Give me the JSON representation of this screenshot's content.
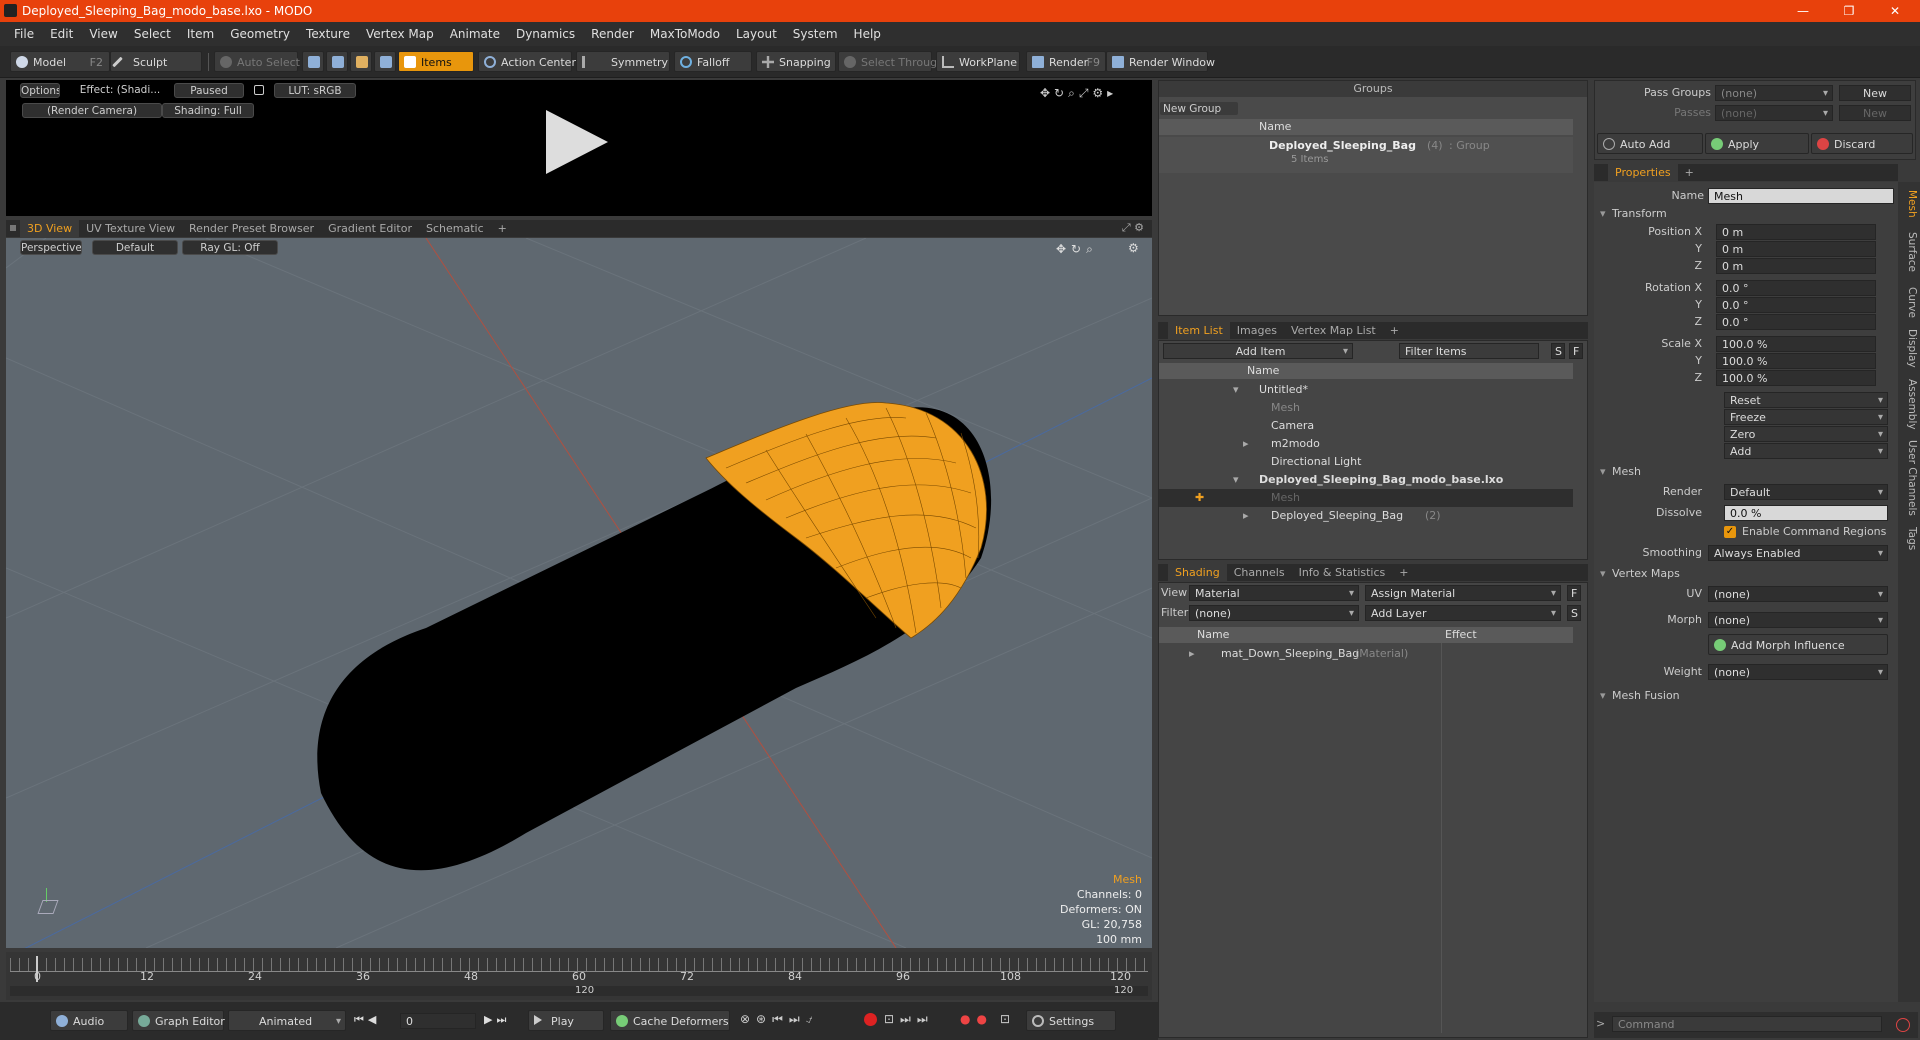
{
  "window": {
    "title": "Deployed_Sleeping_Bag_modo_base.lxo - MODO"
  },
  "menu": [
    "File",
    "Edit",
    "View",
    "Select",
    "Item",
    "Geometry",
    "Texture",
    "Vertex Map",
    "Animate",
    "Dynamics",
    "Render",
    "MaxToModo",
    "Layout",
    "System",
    "Help"
  ],
  "toolbar": {
    "model": "Model",
    "model_key": "F2",
    "sculpt": "Sculpt",
    "auto_select": "Auto Select",
    "items": "Items",
    "action_center": "Action Center",
    "symmetry": "Symmetry",
    "falloff": "Falloff",
    "snapping": "Snapping",
    "select_through": "Select Through",
    "workplane": "WorkPlane",
    "render": "Render",
    "render_key": "F9",
    "render_window": "Render Window"
  },
  "preview": {
    "options": "Options",
    "effect": "Effect: (Shadi...",
    "paused": "Paused",
    "lut": "LUT: sRGB",
    "camera": "(Render Camera)",
    "shading": "Shading: Full"
  },
  "view_tabs": [
    "3D View",
    "UV Texture View",
    "Render Preset Browser",
    "Gradient Editor",
    "Schematic",
    "+"
  ],
  "viewport": {
    "perspective": "Perspective",
    "default": "Default",
    "raygl": "Ray GL: Off",
    "info": {
      "mesh": "Mesh",
      "channels": "Channels: 0",
      "deformers": "Deformers: ON",
      "gl": "GL: 20,758",
      "unit": "100 mm"
    }
  },
  "timeline": {
    "ticks": [
      "0",
      "12",
      "24",
      "36",
      "48",
      "60",
      "72",
      "84",
      "96",
      "108",
      "120"
    ],
    "sub_mid": "120",
    "sub_end": "120"
  },
  "bottombar": {
    "audio": "Audio",
    "graph_editor": "Graph Editor",
    "animated": "Animated",
    "frame": "0",
    "play": "Play",
    "cache": "Cache Deformers",
    "settings": "Settings"
  },
  "groups": {
    "title": "Groups",
    "new_group": "New Group",
    "col_name": "Name",
    "item_name": "Deployed_Sleeping_Bag",
    "item_count": "(4)",
    "item_type": ": Group",
    "item_sub": "5 Items"
  },
  "itemlist": {
    "tabs": [
      "Item List",
      "Images",
      "Vertex Map List",
      "+"
    ],
    "add_item": "Add Item",
    "filter": "Filter Items",
    "s": "S",
    "f": "F",
    "col_name": "Name",
    "rows": [
      {
        "label": "Untitled*"
      },
      {
        "label": "Mesh"
      },
      {
        "label": "Camera"
      },
      {
        "label": "m2modo"
      },
      {
        "label": "Directional Light"
      },
      {
        "label": "Deployed_Sleeping_Bag_modo_base.lxo"
      },
      {
        "label": "Mesh"
      },
      {
        "label": "Deployed_Sleeping_Bag",
        "suffix": "(2)"
      }
    ]
  },
  "shading": {
    "tabs": [
      "Shading",
      "Channels",
      "Info & Statistics",
      "+"
    ],
    "view_label": "View",
    "view_value": "Material",
    "assign": "Assign Material",
    "f": "F",
    "filter_label": "Filter",
    "filter_value": "(none)",
    "add_layer": "Add Layer",
    "s": "S",
    "col_name": "Name",
    "col_effect": "Effect",
    "row_name": "mat_Down_Sleeping_Bag",
    "row_type": "(Material)"
  },
  "passes": {
    "pass_groups": "Pass Groups",
    "passes": "Passes",
    "none1": "(none)",
    "none2": "(none)",
    "new1": "New",
    "new2": "New",
    "auto_add": "Auto Add",
    "apply": "Apply",
    "discard": "Discard"
  },
  "properties": {
    "tab": "Properties",
    "plus": "+",
    "name_label": "Name",
    "name_value": "Mesh",
    "transform": "Transform",
    "pos_label": "Position X",
    "y": "Y",
    "z": "Z",
    "pos": [
      "0 m",
      "0 m",
      "0 m"
    ],
    "rot_label": "Rotation X",
    "rot": [
      "0.0 °",
      "0.0 °",
      "0.0 °"
    ],
    "scale_label": "Scale X",
    "scale": [
      "100.0 %",
      "100.0 %",
      "100.0 %"
    ],
    "reset": "Reset",
    "freeze": "Freeze",
    "zero": "Zero",
    "add": "Add",
    "mesh": "Mesh",
    "render_label": "Render",
    "render_value": "Default",
    "dissolve_label": "Dissolve",
    "dissolve_value": "0.0 %",
    "enable_cmd": "Enable Command Regions",
    "smoothing_label": "Smoothing",
    "smoothing_value": "Always Enabled",
    "vertex_maps": "Vertex Maps",
    "uv_label": "UV",
    "uv_value": "(none)",
    "morph_label": "Morph",
    "morph_value": "(none)",
    "add_morph": "Add Morph Influence",
    "weight_label": "Weight",
    "weight_value": "(none)",
    "mesh_fusion": "Mesh Fusion"
  },
  "side_tabs": [
    "Mesh",
    "Surface",
    "Curve",
    "Display",
    "Assembly",
    "User Channels",
    "Tags"
  ],
  "command": {
    "placeholder": "Command"
  },
  "colors": {
    "accent": "#e8960c",
    "titlebar": "#e8410c"
  }
}
